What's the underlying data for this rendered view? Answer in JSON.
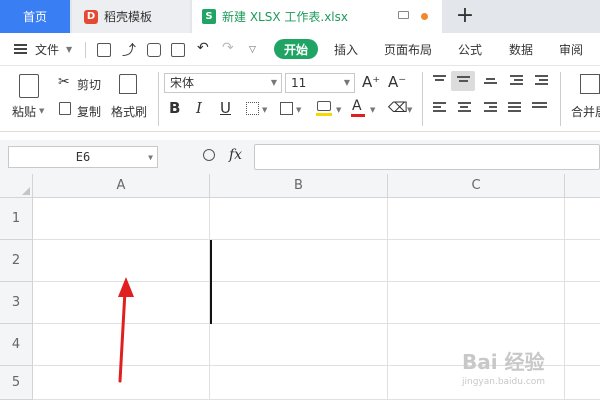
{
  "tabs": {
    "home": "首页",
    "daoke": "稻壳模板",
    "daoke_logo": "D",
    "file": "新建 XLSX 工作表.xlsx",
    "file_logo": "S",
    "new_tab": "+"
  },
  "menu": {
    "file": "文件",
    "active": "开始",
    "items": [
      "插入",
      "页面布局",
      "公式",
      "数据",
      "审阅"
    ]
  },
  "ribbon": {
    "paste": "粘贴",
    "cut": "剪切",
    "copy": "复制",
    "format_painter": "格式刷",
    "font_name": "宋体",
    "font_size": "11",
    "grow_font": "A⁺",
    "shrink_font": "A⁻",
    "bold": "B",
    "italic": "I",
    "underline": "U",
    "font_color": "A",
    "merge": "合并居"
  },
  "formula_bar": {
    "name_box": "E6",
    "fx": "fx",
    "formula": ""
  },
  "grid": {
    "columns": [
      "A",
      "B",
      "C"
    ],
    "rows": [
      "1",
      "2",
      "3",
      "4",
      "5"
    ]
  },
  "watermark": {
    "main": "Bai 经验",
    "sub": "jingyan.baidu.com"
  },
  "colors": {
    "accent_green": "#1fa463",
    "home_tab_blue": "#3a7ef4",
    "annotation_red": "#e02020"
  }
}
